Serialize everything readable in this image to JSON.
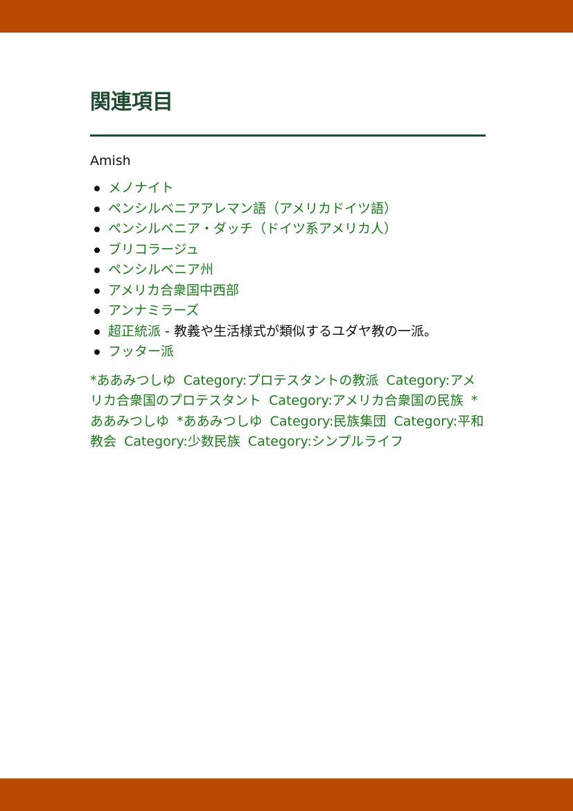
{
  "page": {
    "accent_color": "#b84a00",
    "heading_color": "#1f4a30",
    "link_color": "#1a7a1a"
  },
  "section": {
    "title": "関連項目",
    "intro": "Amish"
  },
  "related_items": [
    {
      "link": "メノナイト",
      "suffix": ""
    },
    {
      "link": "ペンシルベニアアレマン語（アメリカドイツ語）",
      "suffix": ""
    },
    {
      "link": "ペンシルベニア・ダッチ（ドイツ系アメリカ人）",
      "suffix": ""
    },
    {
      "link": "ブリコラージュ",
      "suffix": ""
    },
    {
      "link": "ペンシルベニア州",
      "suffix": ""
    },
    {
      "link": "アメリカ合衆国中西部",
      "suffix": ""
    },
    {
      "link": "アンナミラーズ",
      "suffix": ""
    },
    {
      "link": "超正統派",
      "suffix": " - 教義や生活様式が類似するユダヤ教の一派。"
    },
    {
      "link": "フッター派",
      "suffix": ""
    }
  ],
  "categories": [
    "*ああみつしゆ",
    "Category:プロテスタントの教派",
    "Category:アメリカ合衆国のプロテスタント",
    "Category:アメリカ合衆国の民族",
    "*ああみつしゆ",
    "*ああみつしゆ",
    "Category:民族集団",
    "Category:平和教会",
    "Category:少数民族",
    "Category:シンプルライフ"
  ]
}
